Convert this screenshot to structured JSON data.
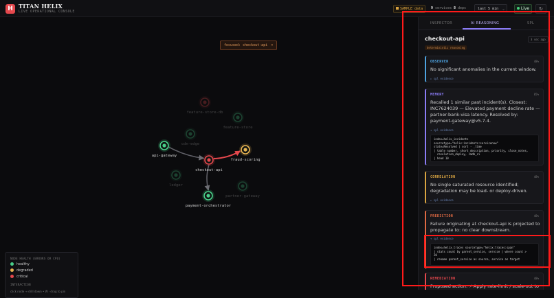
{
  "app": {
    "title": "TITAN HELIX",
    "subtitle": "LIVE OPERATIONAL CONSOLE",
    "logo_letter": "H"
  },
  "topbar": {
    "sample_label": "SAMPLE data",
    "services_count": "9",
    "services_label": "services",
    "deps_count": "8",
    "deps_label": "deps",
    "time_range": "last 5 min",
    "live_label": "Live",
    "refresh_glyph": "↻"
  },
  "graph": {
    "focus_chip": "focused: checkout-api",
    "focus_close": "×",
    "nodes": [
      {
        "id": "api-gateway",
        "label": "api-gateway",
        "status": "healthy",
        "dim": false
      },
      {
        "id": "checkout-api",
        "label": "checkout-api",
        "status": "critical",
        "dim": false
      },
      {
        "id": "fraud-scoring",
        "label": "fraud-scoring",
        "status": "degraded",
        "dim": false
      },
      {
        "id": "payment-orchestrator",
        "label": "payment-orchestrator",
        "status": "healthy",
        "dim": false
      },
      {
        "id": "feature-store-db",
        "label": "feature-store-db",
        "status": "critical",
        "dim": true
      },
      {
        "id": "feature-store",
        "label": "feature-store",
        "status": "healthy",
        "dim": true
      },
      {
        "id": "cdn-edge",
        "label": "cdn-edge",
        "status": "healthy",
        "dim": true
      },
      {
        "id": "ledger",
        "label": "ledger",
        "status": "healthy",
        "dim": true
      },
      {
        "id": "partner-gateway",
        "label": "partner-gateway",
        "status": "healthy",
        "dim": true
      }
    ],
    "edges": [
      {
        "from": "api-gateway",
        "to": "checkout-api",
        "state": "normal"
      },
      {
        "from": "checkout-api",
        "to": "fraud-scoring",
        "state": "critical"
      },
      {
        "from": "checkout-api",
        "to": "payment-orchestrator",
        "state": "normal"
      }
    ]
  },
  "legend": {
    "title": "NODE HEALTH (ERRORS OR CPU)",
    "items": [
      {
        "label": "healthy",
        "color": "#49d08a"
      },
      {
        "label": "degraded",
        "color": "#e8b452"
      },
      {
        "label": "critical",
        "color": "#e5484d"
      }
    ],
    "interaction_title": "INTERACTION",
    "interaction_hint": "click node → drill down • W · drag to pin"
  },
  "panel": {
    "tabs": [
      {
        "label": "INSPECTOR",
        "active": false
      },
      {
        "label": "AI REASONING",
        "active": true
      },
      {
        "label": "SPL",
        "active": false
      }
    ],
    "service": "checkout-api",
    "time_ago": "3 sec ago",
    "mode_badge": "deterministic reasoning",
    "cards": [
      {
        "label": "OBSERVER",
        "confidence": "48%",
        "color": "#4ea3e0",
        "text": "No significant anomalies in the current window.",
        "evidence": "▸ spl evidence",
        "code": ""
      },
      {
        "label": "MEMORY",
        "confidence": "85%",
        "color": "#8b7cf6",
        "text": "Recalled 1 similar past incident(s). Closest: INC7624039 — Elevated payment decline rate — partner-bank-visa latency. Resolved by: payment-gateway@v5.7.4.",
        "evidence": "▾ spl evidence",
        "code": "index=helix_incidents\nsourcetype=\"helix:incidents:servicenow\"\nstate=Resolved | sort - _time\n| table number, short_description, priority, close_notes,\n  resolution_deploy, cmdb_ci\n| head 10"
      },
      {
        "label": "CORRELATION",
        "confidence": "48%",
        "color": "#d9a441",
        "text": "No single saturated resource identified; degradation may be load- or deploy-driven.",
        "evidence": "▸ spl evidence",
        "code": ""
      },
      {
        "label": "PREDICTION",
        "confidence": "48%",
        "color": "#e06a43",
        "text": "Failure originating at checkout-api is projected to propagate to: no clear downstream.",
        "evidence": "▾ spl evidence",
        "code": "index=helix_traces sourcetype=\"helix:traces:span\"\n| stats count by parent_service, service | where count >\n20\n| rename parent_service as source, service as target"
      },
      {
        "label": "REMEDIATION",
        "confidence": "48%",
        "color": "#e5484d",
        "text": "Proposed action: ⚡ Apply rate-limit / scale-out to checkout-api",
        "evidence": "",
        "code": ""
      }
    ]
  }
}
